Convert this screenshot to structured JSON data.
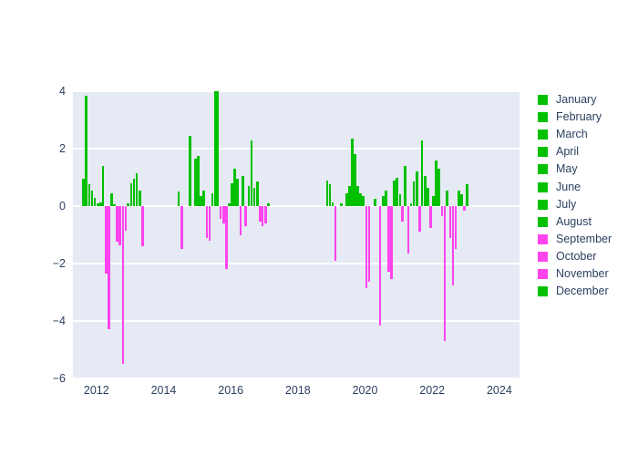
{
  "chart_data": {
    "type": "bar",
    "title": "",
    "xlabel": "",
    "ylabel": "",
    "xlim": [
      2011.3,
      2024.6
    ],
    "ylim": [
      -6.0,
      4.0
    ],
    "grid": true,
    "legend_position": "right",
    "xticks": [
      "2012",
      "2014",
      "2016",
      "2018",
      "2020",
      "2022",
      "2024"
    ],
    "xtick_values": [
      2012,
      2014,
      2016,
      2018,
      2020,
      2022,
      2024
    ],
    "yticks": [
      "4",
      "2",
      "0",
      "−2",
      "−4",
      "−6"
    ],
    "ytick_values": [
      4,
      2,
      0,
      -2,
      -4,
      -6
    ],
    "colors": {
      "positive_green": "#00C000",
      "negative_magenta": "#FF44EE",
      "plot_background": "#E5EAF4",
      "paper_background": "#FFFFFF",
      "gridline": "#FFFFFF",
      "tick_text": "#2A3F5F"
    },
    "legend": [
      {
        "label": "January",
        "color": "#00C000"
      },
      {
        "label": "February",
        "color": "#00C000"
      },
      {
        "label": "March",
        "color": "#00C000"
      },
      {
        "label": "April",
        "color": "#00C000"
      },
      {
        "label": "May",
        "color": "#00C000"
      },
      {
        "label": "June",
        "color": "#00C000"
      },
      {
        "label": "July",
        "color": "#00C000"
      },
      {
        "label": "August",
        "color": "#00C000"
      },
      {
        "label": "September",
        "color": "#FF44EE"
      },
      {
        "label": "October",
        "color": "#FF44EE"
      },
      {
        "label": "November",
        "color": "#FF44EE"
      },
      {
        "label": "December",
        "color": "#00C000"
      }
    ],
    "x": [
      2011.62,
      2011.7,
      2011.79,
      2011.87,
      2011.95,
      2012.04,
      2012.12,
      2012.2,
      2012.29,
      2012.37,
      2012.45,
      2012.54,
      2012.62,
      2012.7,
      2012.79,
      2012.87,
      2012.95,
      2013.04,
      2013.12,
      2013.2,
      2013.29,
      2013.37,
      2014.45,
      2014.54,
      2014.79,
      2014.95,
      2015.04,
      2015.12,
      2015.2,
      2015.29,
      2015.37,
      2015.45,
      2015.54,
      2015.62,
      2015.7,
      2015.79,
      2015.87,
      2015.95,
      2016.04,
      2016.12,
      2016.2,
      2016.29,
      2016.37,
      2016.45,
      2016.54,
      2016.62,
      2016.7,
      2016.79,
      2016.87,
      2016.95,
      2017.04,
      2017.12,
      2018.87,
      2018.95,
      2019.04,
      2019.12,
      2019.29,
      2019.45,
      2019.54,
      2019.62,
      2019.7,
      2019.79,
      2019.87,
      2019.95,
      2020.04,
      2020.12,
      2020.29,
      2020.45,
      2020.54,
      2020.62,
      2020.7,
      2020.79,
      2020.87,
      2020.95,
      2021.04,
      2021.12,
      2021.2,
      2021.29,
      2021.37,
      2021.45,
      2021.54,
      2021.62,
      2021.7,
      2021.79,
      2021.87,
      2021.95,
      2022.04,
      2022.12,
      2022.2,
      2022.29,
      2022.37,
      2022.45,
      2022.54,
      2022.62,
      2022.7,
      2022.79,
      2022.87,
      2022.95,
      2023.04
    ],
    "values": [
      0.95,
      3.85,
      0.75,
      0.55,
      0.3,
      0.1,
      0.12,
      1.4,
      -2.35,
      -4.3,
      0.45,
      0.05,
      -1.25,
      -1.35,
      -5.5,
      -0.85,
      0.1,
      0.8,
      0.95,
      1.15,
      0.55,
      -1.4,
      0.5,
      -1.5,
      2.45,
      1.65,
      1.75,
      0.35,
      0.55,
      -1.1,
      -1.2,
      0.45,
      4.35,
      4.2,
      -0.45,
      -0.6,
      -2.2,
      0.1,
      0.8,
      1.3,
      0.95,
      -1.0,
      1.05,
      -0.7,
      0.7,
      2.3,
      0.65,
      0.85,
      -0.55,
      -0.7,
      -0.6,
      0.1,
      0.9,
      0.75,
      0.12,
      -1.9,
      0.1,
      0.45,
      0.7,
      2.35,
      1.8,
      0.7,
      0.45,
      0.35,
      -2.85,
      -2.65,
      0.25,
      -4.15,
      0.35,
      0.55,
      -2.3,
      -2.55,
      0.9,
      1.0,
      0.4,
      -0.55,
      1.4,
      -1.65,
      0.1,
      0.85,
      1.2,
      -0.9,
      2.3,
      1.05,
      0.65,
      -0.75,
      0.35,
      1.6,
      1.3,
      -0.35,
      -4.7,
      0.55,
      -1.1,
      -2.75,
      -1.5,
      0.55,
      0.4,
      -0.15,
      0.75
    ]
  }
}
